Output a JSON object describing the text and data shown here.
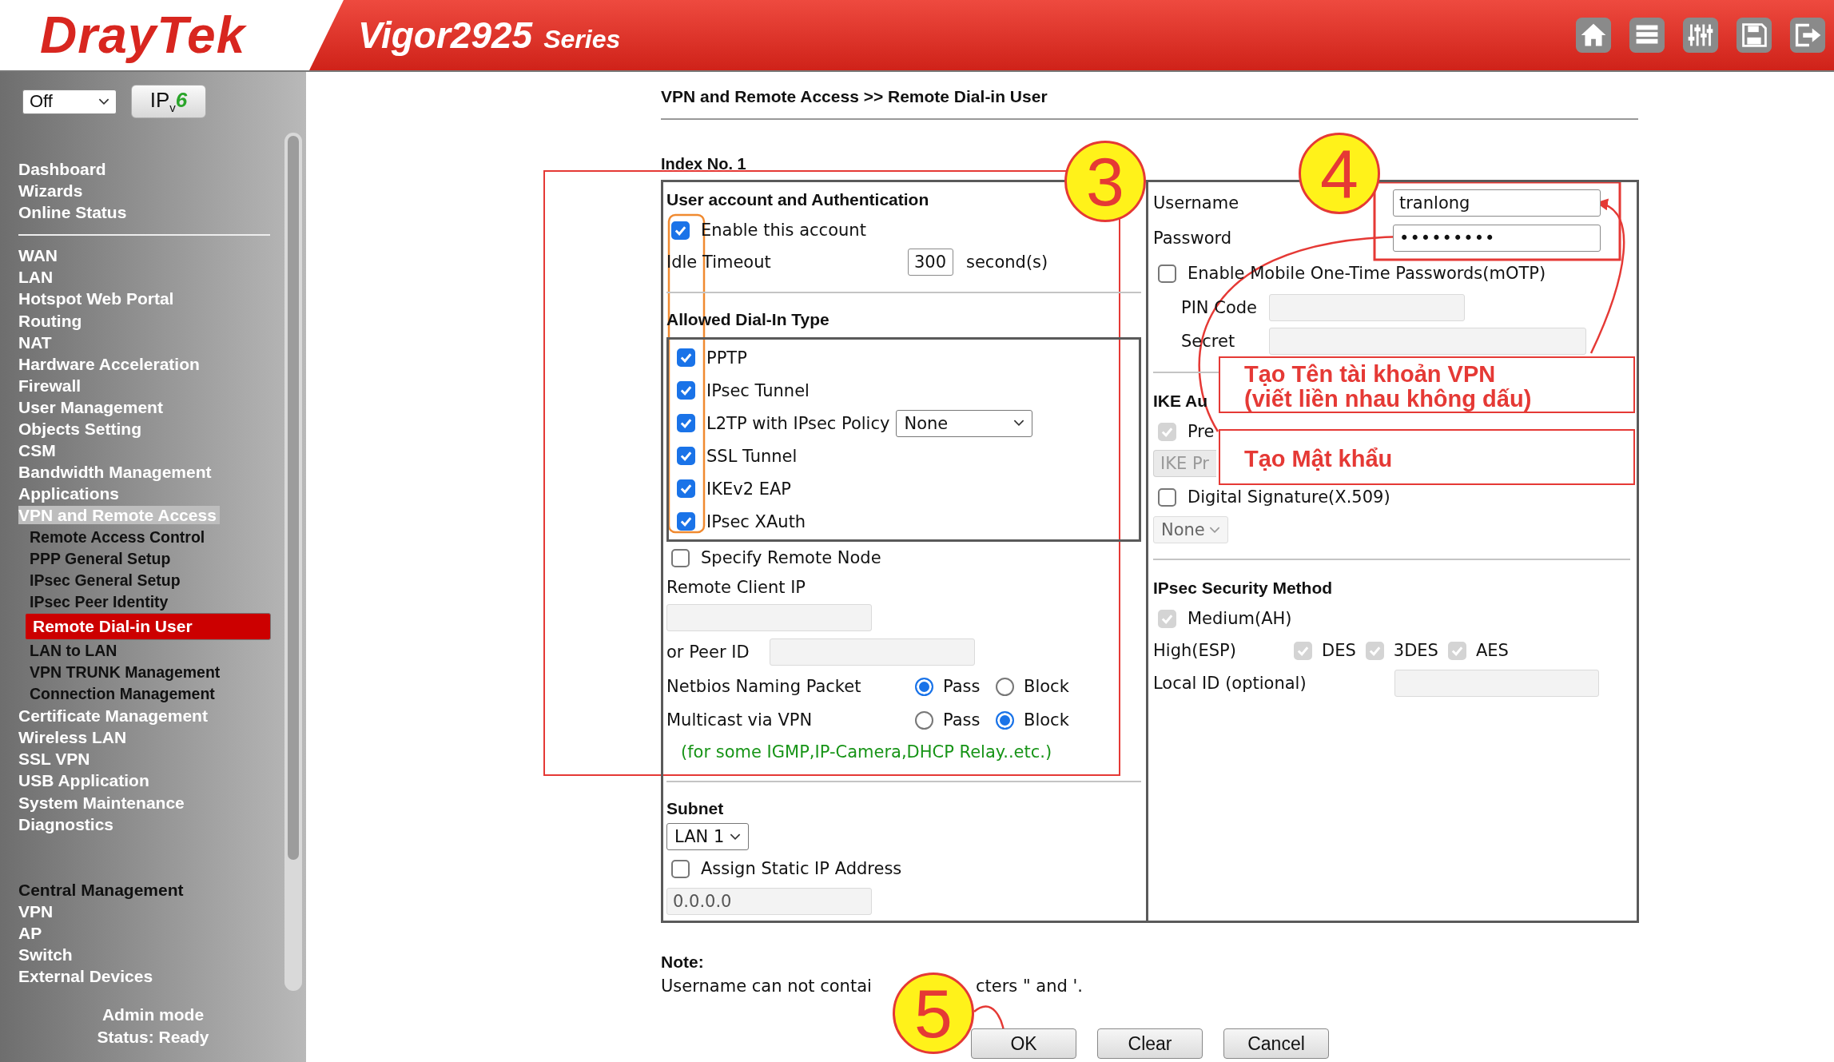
{
  "header": {
    "logo": "DrayTek",
    "model": "Vigor2925",
    "series": "Series"
  },
  "sidebar": {
    "mode_select": "Off",
    "ipv6_logo": "IP$_{v}$**6**",
    "sections": [
      {
        "items": [
          {
            "label": "Dashboard",
            "expanded": false
          },
          {
            "label": "Wizards",
            "expanded": false
          },
          {
            "label": "Online Status",
            "expanded": false
          }
        ]
      },
      {
        "items": [
          {
            "label": "WAN",
            "expanded": false
          },
          {
            "label": "LAN",
            "expanded": false
          },
          {
            "label": "Hotspot Web Portal",
            "expanded": false
          },
          {
            "label": "Routing",
            "expanded": false
          },
          {
            "label": "NAT",
            "expanded": false
          },
          {
            "label": "Hardware Acceleration",
            "expanded": false
          },
          {
            "label": "Firewall",
            "expanded": false
          },
          {
            "label": "User Management",
            "expanded": false
          },
          {
            "label": "Objects Setting",
            "expanded": false
          },
          {
            "label": "CSM",
            "expanded": false
          },
          {
            "label": "Bandwidth Management",
            "expanded": false
          },
          {
            "label": "Applications",
            "expanded": false
          },
          {
            "label": "VPN and Remote Access",
            "expanded": true,
            "children": [
              {
                "label": "Remote Access Control",
                "selected": false
              },
              {
                "label": "PPP General Setup",
                "selected": false
              },
              {
                "label": "IPsec General Setup",
                "selected": false
              },
              {
                "label": "IPsec Peer Identity",
                "selected": false
              },
              {
                "label": "Remote Dial-in User",
                "selected": true
              },
              {
                "label": "LAN to LAN",
                "selected": false
              },
              {
                "label": "VPN TRUNK Management",
                "selected": false
              },
              {
                "label": "Connection Management",
                "selected": false
              }
            ]
          },
          {
            "label": "Certificate Management",
            "expanded": false
          },
          {
            "label": "Wireless LAN",
            "expanded": false
          },
          {
            "label": "SSL VPN",
            "expanded": false
          },
          {
            "label": "USB Application",
            "expanded": false
          },
          {
            "label": "System Maintenance",
            "expanded": false
          },
          {
            "label": "Diagnostics",
            "expanded": false
          }
        ]
      },
      {
        "heading": "Central Management",
        "items": [
          {
            "label": "VPN",
            "expanded": false
          },
          {
            "label": "AP",
            "expanded": false
          },
          {
            "label": "Switch",
            "expanded": false
          },
          {
            "label": "External Devices",
            "expanded": false
          }
        ]
      }
    ],
    "status": [
      "Admin mode",
      "Status: Ready"
    ]
  },
  "breadcrumb": "VPN and Remote Access >> Remote Dial-in User",
  "index_label": "Index No. 1",
  "account": {
    "title": "User account and Authentication",
    "enable": {
      "label": "Enable this account",
      "checked": true
    },
    "idle_timeout": {
      "label": "Idle Timeout",
      "value": "300",
      "unit": "second(s)"
    },
    "dial_in_title": "Allowed Dial-In Type",
    "dial_in_types": [
      {
        "kind": "check",
        "label": "PPTP",
        "checked": true
      },
      {
        "kind": "check",
        "label": "IPsec Tunnel",
        "checked": true
      },
      {
        "kind": "check_select",
        "label": "L2TP with IPsec Policy",
        "checked": true,
        "policy": "None"
      },
      {
        "kind": "check",
        "label": "SSL Tunnel",
        "checked": true
      },
      {
        "kind": "check",
        "label": "IKEv2 EAP",
        "checked": true
      },
      {
        "kind": "check",
        "label": "IPsec XAuth",
        "checked": true
      }
    ],
    "specify_remote_node": {
      "label": "Specify Remote Node",
      "checked": false
    },
    "remote_client_ip": {
      "label": "Remote Client IP",
      "disabled": true
    },
    "peer_id": {
      "label": "or Peer ID",
      "disabled": true
    },
    "options": [
      {
        "label": "Netbios Naming Packet",
        "choices": [
          {
            "label": "Pass",
            "selected": true
          },
          {
            "label": "Block",
            "selected": false
          }
        ]
      },
      {
        "label": "Multicast via VPN",
        "choices": [
          {
            "label": "Pass",
            "selected": false
          },
          {
            "label": "Block",
            "selected": true
          }
        ]
      }
    ],
    "multicast_hint": "(for some IGMP,IP-Camera,DHCP Relay..etc.)",
    "subnet_title": "Subnet",
    "subnet": "LAN 1",
    "static_ip": {
      "label": "Assign Static IP Address",
      "checked": false
    },
    "static_ip_field": {
      "value": "0.0.0.0",
      "disabled": true
    }
  },
  "credentials": {
    "username": {
      "label": "Username",
      "value": "tranlong"
    },
    "password": {
      "label": "Password",
      "value": "•••••••••"
    },
    "motp": {
      "label": "Enable Mobile One-Time Passwords(mOTP)",
      "checked": false
    },
    "pin_code": {
      "label": "PIN Code",
      "disabled": true
    },
    "secret": {
      "label": "Secret",
      "disabled": true
    },
    "ike_title": "IKE Au",
    "pre_shared": {
      "label": "Pre",
      "checked": true,
      "disabled": true
    },
    "ike_button": "IKE Pr",
    "digital_signature": {
      "label": "Digital Signature(X.509)",
      "checked": false
    },
    "signature_select": {
      "value": "None",
      "disabled": true
    },
    "security_title": "IPsec Security Method",
    "medium": {
      "label": "Medium(AH)",
      "checked": true,
      "disabled": true
    },
    "high_label": "High(ESP)",
    "high_options": [
      {
        "label": "DES",
        "checked": true,
        "disabled": true
      },
      {
        "label": "3DES",
        "checked": true,
        "disabled": true
      },
      {
        "label": "AES",
        "checked": true,
        "disabled": true
      }
    ],
    "local_id": {
      "label": "Local ID (optional)",
      "disabled": true
    }
  },
  "note": {
    "title": "Note:",
    "text_before": "Username can not contai",
    "text_after": "cters \" and '."
  },
  "buttons": [
    "OK",
    "Clear",
    "Cancel"
  ],
  "annotations": {
    "steps": [
      "3",
      "4",
      "5"
    ],
    "callouts": [
      {
        "lines": [
          "Tạo Tên tài khoản VPN",
          "(viết liền nhau không dấu)"
        ]
      },
      {
        "lines": [
          "Tạo Mật khẩu"
        ]
      }
    ]
  }
}
